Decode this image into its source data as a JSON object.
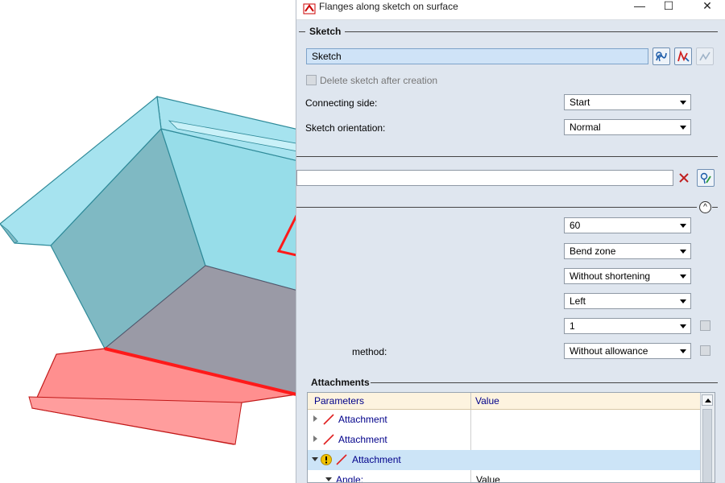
{
  "window": {
    "title": "Flanges along sketch on surface"
  },
  "sketch_section": {
    "title": "Sketch",
    "sketch_field_value": "Sketch",
    "delete_after_creation_label": "Delete sketch after creation",
    "connecting_side": {
      "label": "Connecting side:",
      "value": "Start"
    },
    "sketch_orientation": {
      "label": "Sketch orientation:",
      "value": "Normal"
    }
  },
  "surface_section": {
    "field_value": ""
  },
  "parameters_section": {
    "combos": [
      {
        "value": "60"
      },
      {
        "value": "Bend zone"
      },
      {
        "value": "Without shortening"
      },
      {
        "value": "Left"
      },
      {
        "value": "1"
      },
      {
        "value": "Without allowance"
      }
    ],
    "partial_label": "method:"
  },
  "attachments": {
    "title": "Attachments",
    "columns": [
      "Parameters",
      "Value"
    ],
    "rows": [
      {
        "label": "Attachment",
        "value": "",
        "expanded": false,
        "selected": false
      },
      {
        "label": "Attachment",
        "value": "",
        "expanded": false,
        "selected": false
      },
      {
        "label": "Attachment",
        "value": "",
        "expanded": true,
        "selected": true
      },
      {
        "label": "Angle:",
        "value": "Value",
        "expanded": true,
        "selected": false
      }
    ]
  },
  "colors": {
    "part_cyan": "#8fdbe8",
    "part_red": "#ff8f8f",
    "bottom_grey": "#9a9aa6",
    "dialog_bg": "#dfe6ef",
    "selection": "#cce4f7"
  },
  "icons": [
    "app-icon",
    "minimize-icon",
    "maximize-icon",
    "close-icon",
    "select-sketch-icon",
    "edit-sketch-icon",
    "new-sketch-icon",
    "clear-icon",
    "select-surface-icon",
    "collapse-icon",
    "warning-icon",
    "attachment-icon"
  ]
}
